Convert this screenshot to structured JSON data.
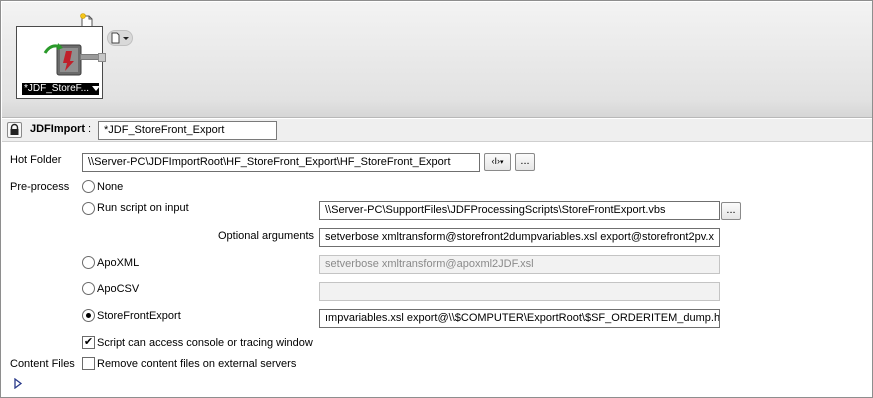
{
  "canvas": {
    "node_label": "*JDF_StoreF..."
  },
  "header": {
    "type_label": "JDFImport",
    "colon": ":",
    "name_value": "*JDF_StoreFront_Export"
  },
  "form": {
    "hot_folder_label": "Hot Folder",
    "hot_folder_value": "\\\\Server-PC\\JDFImportRoot\\HF_StoreFront_Export\\HF_StoreFront_Export",
    "variable_button_label": "‹I›",
    "browse_label": "...",
    "preprocess_label": "Pre-process",
    "options": {
      "none": "None",
      "run_script": "Run script on input",
      "apoxml": "ApoXML",
      "apocsv": "ApoCSV",
      "storefrontexport": "StoreFrontExport"
    },
    "selected_option": "StoreFrontExport",
    "script_path": "\\\\Server-PC\\SupportFiles\\JDFProcessingScripts\\StoreFrontExport.vbs",
    "optional_args_label": "Optional arguments",
    "optional_args_value": "setverbose xmltransform@storefront2dumpvariables.xsl export@storefront2pv.x",
    "apoxml_args": "setverbose xmltransform@apoxml2JDF.xsl",
    "apocsv_args": "",
    "storefront_args": "ımpvariables.xsl export@\\\\$COMPUTER\\ExportRoot\\$SF_ORDERITEM_dump.htm",
    "script_console_label": "Script can access console or tracing window",
    "script_console_checked": true,
    "content_files_label": "Content Files",
    "remove_content_label": "Remove content files on external servers",
    "remove_content_checked": false
  },
  "icons": {
    "lock": "lock-icon",
    "new_doc": "new-document-icon",
    "node": "jdf-import-node-icon",
    "expand": "expand-triangle-icon"
  }
}
